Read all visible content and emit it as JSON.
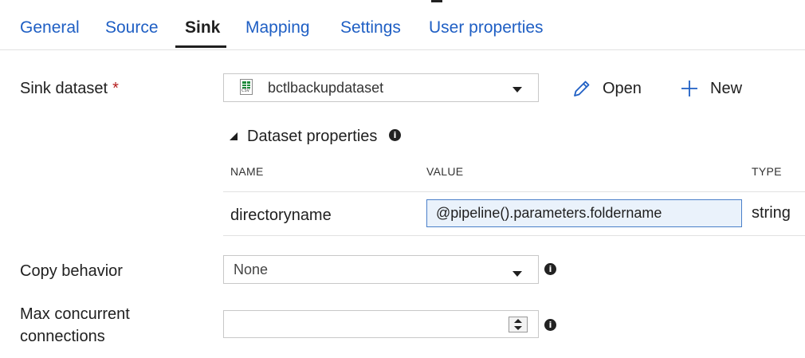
{
  "tabs": [
    {
      "label": "General"
    },
    {
      "label": "Source"
    },
    {
      "label": "Sink",
      "active": true
    },
    {
      "label": "Mapping"
    },
    {
      "label": "Settings"
    },
    {
      "label": "User properties"
    }
  ],
  "sink_dataset": {
    "label": "Sink dataset",
    "required_mark": "*",
    "selected": "bctlbackupdataset",
    "icon": "csv-file-icon",
    "icon_text": "CSV",
    "open_label": "Open",
    "new_label": "New"
  },
  "dataset_properties": {
    "title": "Dataset properties",
    "columns": [
      "NAME",
      "VALUE",
      "TYPE"
    ],
    "rows": [
      {
        "name": "directoryname",
        "value": "@pipeline().parameters.foldername",
        "type": "string"
      }
    ]
  },
  "copy_behavior": {
    "label": "Copy behavior",
    "selected": "None"
  },
  "max_connections": {
    "label_line1": "Max concurrent",
    "label_line2": "connections",
    "value": ""
  },
  "colors": {
    "accent": "#1f5fc4",
    "required": "#b51c1c",
    "focus_border": "#4a7fc9",
    "focus_bg": "#eaf2fb"
  }
}
